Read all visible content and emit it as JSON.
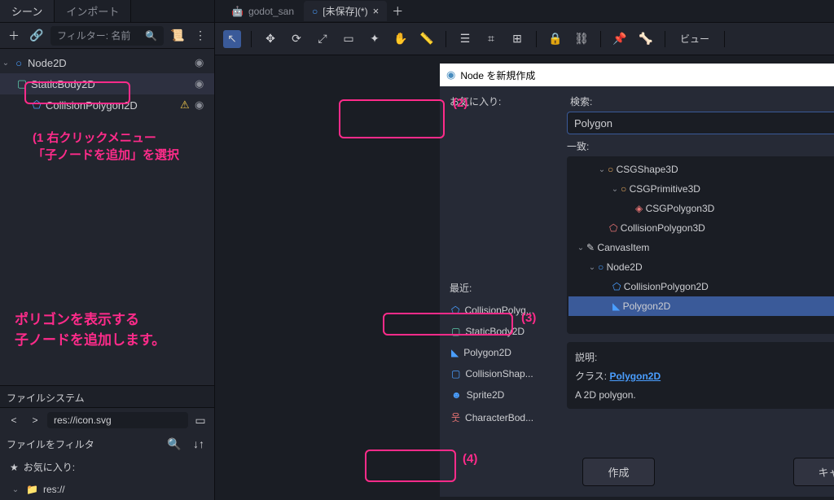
{
  "left": {
    "tabs": {
      "scene": "シーン",
      "import": "インポート"
    },
    "filter_label": "フィルター: 名前",
    "tree": {
      "node2d": "Node2D",
      "static_body": "StaticBody2D",
      "collision_poly": "CollisionPolygon2D"
    },
    "fs_header": "ファイルシステム",
    "path": "res://icon.svg",
    "filter_files": "ファイルをフィルタ",
    "favorites": "お気に入り:",
    "res": "res://"
  },
  "script_tabs": {
    "godot_san": "godot_san",
    "unsaved": "[未保存](*)"
  },
  "canvas_toolbar": {
    "view": "ビュー"
  },
  "dialog": {
    "title": "Node を新規作成",
    "favorites_label": "お気に入り:",
    "recent_label": "最近:",
    "recent": {
      "collision_poly": "CollisionPolyg...",
      "static_body": "StaticBody2D",
      "polygon2d": "Polygon2D",
      "collision_shape": "CollisionShap...",
      "sprite2d": "Sprite2D",
      "character_body": "CharacterBod..."
    },
    "search_label": "検索:",
    "search_value": "Polygon",
    "match_label": "一致:",
    "matches": {
      "csgshape3d": "CSGShape3D",
      "csgprimitive3d": "CSGPrimitive3D",
      "csgpolygon3d": "CSGPolygon3D",
      "collisionpolygon3d": "CollisionPolygon3D",
      "canvasitem": "CanvasItem",
      "node2d": "Node2D",
      "collisionpolygon2d": "CollisionPolygon2D",
      "polygon2d": "Polygon2D"
    },
    "desc_label": "説明:",
    "class_label": "クラス:",
    "class_name": "Polygon2D",
    "desc_text": "A 2D polygon.",
    "create_btn": "作成",
    "cancel_btn": "キャンセル"
  },
  "annotations": {
    "a1_line1": "(1 右クリックメニュー",
    "a1_line2": "「子ノードを追加」を選択",
    "a2": "(2)",
    "a3": "(3)",
    "a4": "(4)",
    "note_line1": "ポリゴンを表示する",
    "note_line2": "子ノードを追加します。"
  }
}
